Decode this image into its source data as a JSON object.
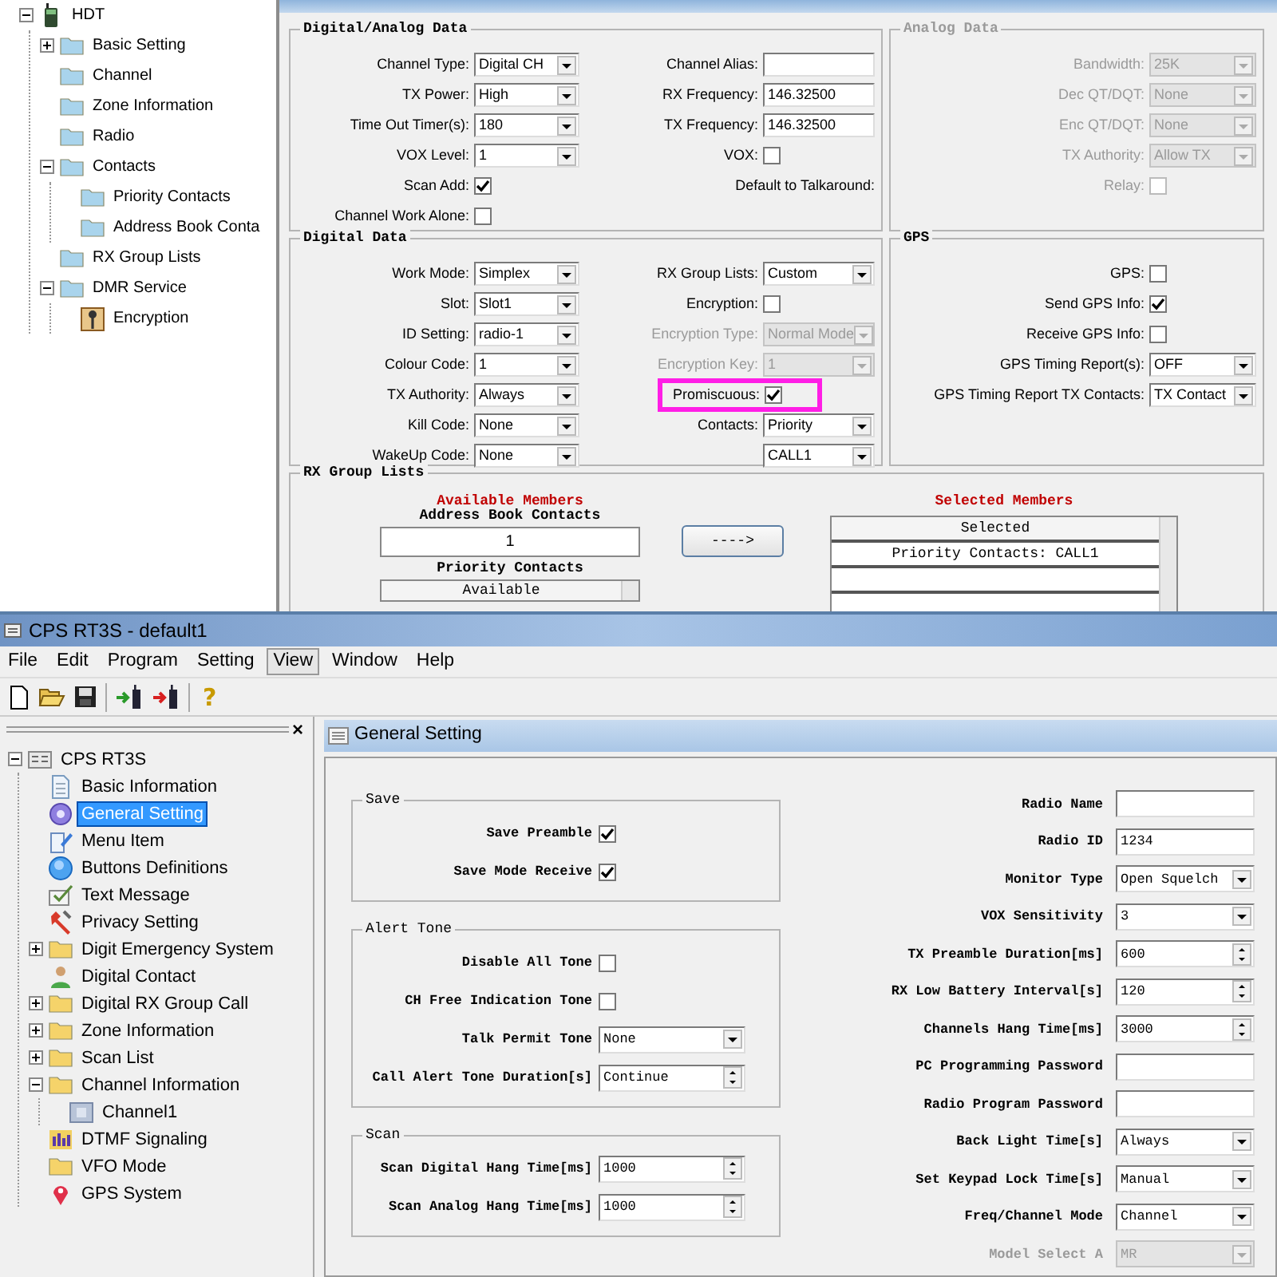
{
  "top": {
    "tree": [
      {
        "label": "HDT",
        "kind": "radio",
        "expanded": true,
        "selected": false,
        "children": [
          {
            "label": "Basic Setting",
            "kind": "folder",
            "expanded": false,
            "selected": false
          },
          {
            "label": "Channel",
            "kind": "folder",
            "selected": false
          },
          {
            "label": "Zone Information",
            "kind": "folder",
            "selected": false
          },
          {
            "label": "Radio",
            "kind": "folder",
            "selected": false
          },
          {
            "label": "Contacts",
            "kind": "folder",
            "expanded": true,
            "selected": false,
            "children": [
              {
                "label": "Priority Contacts",
                "kind": "folder",
                "selected": false
              },
              {
                "label": "Address Book Conta",
                "kind": "folder",
                "selected": false
              }
            ]
          },
          {
            "label": "RX Group Lists",
            "kind": "folder",
            "selected": false
          },
          {
            "label": "DMR Service",
            "kind": "folder",
            "expanded": true,
            "selected": false,
            "children": [
              {
                "label": "Encryption",
                "kind": "key",
                "selected": false
              }
            ]
          }
        ]
      }
    ],
    "digital_analog": {
      "title": "Digital/Analog Data",
      "disabled": false,
      "columns": [
        [
          {
            "label": "Channel Type:",
            "kind": "select",
            "value": "Digital CH",
            "disabled": false,
            "highlighted": false
          },
          {
            "label": "TX Power:",
            "kind": "select",
            "value": "High",
            "disabled": false,
            "highlighted": false
          },
          {
            "label": "Time Out Timer(s):",
            "kind": "select",
            "value": "180",
            "disabled": false,
            "highlighted": false
          },
          {
            "label": "VOX Level:",
            "kind": "select",
            "value": "1",
            "disabled": false,
            "highlighted": false
          },
          {
            "label": "Scan Add:",
            "kind": "check",
            "checked": true,
            "disabled": false,
            "highlighted": false
          },
          {
            "label": "Channel Work Alone:",
            "kind": "check",
            "checked": false,
            "disabled": false,
            "highlighted": false
          }
        ],
        [
          {
            "label": "Channel Alias:",
            "kind": "text",
            "disabled": false,
            "highlighted": false
          },
          {
            "label": "RX Frequency:",
            "kind": "text",
            "value": "146.32500",
            "disabled": false,
            "highlighted": false
          },
          {
            "label": "TX Frequency:",
            "kind": "text",
            "value": "146.32500",
            "disabled": false,
            "highlighted": false
          },
          {
            "label": "VOX:",
            "kind": "check",
            "checked": false,
            "disabled": false,
            "highlighted": false
          },
          {
            "label": "Default to Talkaround:",
            "kind": "label",
            "disabled": false,
            "highlighted": false
          }
        ]
      ]
    },
    "analog": {
      "title": "Analog Data",
      "disabled": true,
      "columns": [
        [
          {
            "label": "Bandwidth:",
            "kind": "select",
            "value": "25K",
            "disabled": true,
            "highlighted": false
          },
          {
            "label": "Dec QT/DQT:",
            "kind": "select",
            "value": "None",
            "disabled": true,
            "highlighted": false
          },
          {
            "label": "Enc QT/DQT:",
            "kind": "select",
            "value": "None",
            "disabled": true,
            "highlighted": false
          },
          {
            "label": "TX Authority:",
            "kind": "select",
            "value": "Allow TX",
            "disabled": true,
            "highlighted": false
          },
          {
            "label": "Relay:",
            "kind": "check",
            "checked": false,
            "disabled": true,
            "highlighted": false
          }
        ]
      ]
    },
    "digital_data": {
      "title": "Digital Data",
      "disabled": false,
      "columns": [
        [
          {
            "label": "Work Mode:",
            "kind": "select",
            "value": "Simplex",
            "disabled": false,
            "highlighted": false
          },
          {
            "label": "Slot:",
            "kind": "select",
            "value": "Slot1",
            "disabled": false,
            "highlighted": false
          },
          {
            "label": "ID Setting:",
            "kind": "select",
            "value": "radio-1",
            "disabled": false,
            "highlighted": false
          },
          {
            "label": "Colour Code:",
            "kind": "select",
            "value": "1",
            "disabled": false,
            "highlighted": false
          },
          {
            "label": "TX Authority:",
            "kind": "select",
            "value": "Always",
            "disabled": false,
            "highlighted": false
          },
          {
            "label": "Kill Code:",
            "kind": "select",
            "value": "None",
            "disabled": false,
            "highlighted": false
          },
          {
            "label": "WakeUp Code:",
            "kind": "select",
            "value": "None",
            "disabled": false,
            "highlighted": false
          }
        ],
        [
          {
            "label": "RX Group Lists:",
            "kind": "select",
            "value": "Custom",
            "disabled": false,
            "highlighted": false
          },
          {
            "label": "Encryption:",
            "kind": "check",
            "checked": false,
            "disabled": false,
            "highlighted": false
          },
          {
            "label": "Encryption Type:",
            "kind": "select",
            "value": "Normal Mode",
            "disabled": true,
            "highlighted": false
          },
          {
            "label": "Encryption Key:",
            "kind": "select",
            "value": "1",
            "disabled": true,
            "highlighted": false
          },
          {
            "label": "Promiscuous:",
            "kind": "check",
            "checked": true,
            "disabled": false,
            "highlighted": true
          },
          {
            "label": "Contacts:",
            "kind": "select",
            "value": "Priority",
            "disabled": false,
            "highlighted": false
          },
          {
            "kind": "select",
            "value": "CALL1",
            "disabled": false,
            "highlighted": false
          }
        ]
      ]
    },
    "gps": {
      "title": "GPS",
      "disabled": false,
      "columns": [
        [
          {
            "label": "GPS:",
            "kind": "check",
            "checked": false,
            "disabled": false,
            "highlighted": false
          },
          {
            "label": "Send GPS Info:",
            "kind": "check",
            "checked": true,
            "disabled": false,
            "highlighted": false
          },
          {
            "label": "Receive GPS Info:",
            "kind": "check",
            "checked": false,
            "disabled": false,
            "highlighted": false
          },
          {
            "label": "GPS Timing Report(s):",
            "kind": "select",
            "value": "OFF",
            "disabled": false,
            "highlighted": false
          },
          {
            "label": "GPS Timing Report TX Contacts:",
            "kind": "select",
            "value": "TX Contact",
            "disabled": false,
            "highlighted": false
          }
        ]
      ]
    },
    "rx_group": {
      "title": "RX Group Lists",
      "available_title": "Available Members",
      "address_label": "Address Book Contacts",
      "address_value": "1",
      "add_button": "---->",
      "priority_label": "Priority Contacts",
      "available_header": "Available",
      "selected_title": "Selected Members",
      "selected_header": "Selected",
      "selected_rows": [
        "Priority Contacts: CALL1"
      ]
    }
  },
  "bottom": {
    "title": "CPS RT3S - default1",
    "menu": [
      {
        "label": "File",
        "selected": false
      },
      {
        "label": "Edit",
        "selected": false
      },
      {
        "label": "Program",
        "selected": false
      },
      {
        "label": "Setting",
        "selected": false
      },
      {
        "label": "View",
        "selected": true
      },
      {
        "label": "Window",
        "selected": false
      },
      {
        "label": "Help",
        "selected": false
      }
    ],
    "help_glyph": "?",
    "tree_close": "×",
    "tree": [
      {
        "label": "CPS RT3S",
        "kind": "app",
        "expanded": true,
        "selected": false,
        "children": [
          {
            "label": "Basic Information",
            "kind": "document",
            "selected": false
          },
          {
            "label": "General Setting",
            "kind": "gear",
            "selected": true
          },
          {
            "label": "Menu Item",
            "kind": "edit",
            "selected": false
          },
          {
            "label": "Buttons Definitions",
            "kind": "circle",
            "selected": false
          },
          {
            "label": "Text Message",
            "kind": "message",
            "selected": false
          },
          {
            "label": "Privacy Setting",
            "kind": "tool",
            "selected": false
          },
          {
            "label": "Digit Emergency System",
            "kind": "folder",
            "expanded": false,
            "selected": false
          },
          {
            "label": "Digital Contact",
            "kind": "person",
            "selected": false
          },
          {
            "label": "Digital RX Group Call",
            "kind": "folder",
            "expanded": false,
            "selected": false
          },
          {
            "label": "Zone Information",
            "kind": "folder",
            "expanded": false,
            "selected": false
          },
          {
            "label": "Scan List",
            "kind": "folder",
            "expanded": false,
            "selected": false
          },
          {
            "label": "Channel Information",
            "kind": "folder",
            "expanded": true,
            "selected": false,
            "children": [
              {
                "label": "Channel1",
                "kind": "channel",
                "selected": false
              }
            ]
          },
          {
            "label": "DTMF Signaling",
            "kind": "dtmf",
            "selected": false
          },
          {
            "label": "VFO Mode",
            "kind": "folder",
            "selected": false
          },
          {
            "label": "GPS System",
            "kind": "pin",
            "selected": false
          }
        ]
      }
    ],
    "panel_title": "General Setting",
    "groups": [
      {
        "title": "Save",
        "fields": [
          {
            "label": "Save Preamble",
            "kind": "check",
            "checked": true,
            "disabled": false
          },
          {
            "label": "Save Mode Receive",
            "kind": "check",
            "checked": true,
            "disabled": false
          }
        ]
      },
      {
        "title": "Alert Tone",
        "fields": [
          {
            "label": "Disable All Tone",
            "kind": "check",
            "checked": false,
            "disabled": false
          },
          {
            "label": "CH Free Indication Tone",
            "kind": "check",
            "checked": false,
            "disabled": false
          },
          {
            "label": "Talk Permit Tone",
            "kind": "select",
            "value": "None",
            "disabled": false
          },
          {
            "label": "Call Alert Tone Duration[s]",
            "kind": "spin",
            "value": "Continue",
            "disabled": false
          }
        ]
      },
      {
        "title": "Scan",
        "fields": [
          {
            "label": "Scan Digital Hang Time[ms]",
            "kind": "spin",
            "value": "1000",
            "disabled": false
          },
          {
            "label": "Scan Analog Hang Time[ms]",
            "kind": "spin",
            "value": "1000",
            "disabled": false
          }
        ]
      }
    ],
    "fields": [
      {
        "label": "Radio Name",
        "kind": "text",
        "disabled": false
      },
      {
        "label": "Radio ID",
        "kind": "text",
        "value": "1234",
        "disabled": false
      },
      {
        "label": "Monitor Type",
        "kind": "select",
        "value": "Open Squelch",
        "disabled": false
      },
      {
        "label": "VOX Sensitivity",
        "kind": "select",
        "value": "3",
        "disabled": false
      },
      {
        "label": "TX Preamble Duration[ms]",
        "kind": "spin",
        "value": "600",
        "disabled": false
      },
      {
        "label": "RX Low Battery Interval[s]",
        "kind": "spin",
        "value": "120",
        "disabled": false
      },
      {
        "label": "Channels Hang Time[ms]",
        "kind": "spin",
        "value": "3000",
        "disabled": false
      },
      {
        "label": "PC Programming Password",
        "kind": "text",
        "disabled": false
      },
      {
        "label": "Radio Program Password",
        "kind": "text",
        "disabled": false
      },
      {
        "label": "Back Light Time[s]",
        "kind": "select",
        "value": "Always",
        "disabled": false
      },
      {
        "label": "Set Keypad Lock Time[s]",
        "kind": "select",
        "value": "Manual",
        "disabled": false
      },
      {
        "label": "Freq/Channel Mode",
        "kind": "select",
        "value": "Channel",
        "disabled": false
      },
      {
        "label": "Model Select A",
        "kind": "select",
        "value": "MR",
        "disabled": true
      }
    ]
  }
}
